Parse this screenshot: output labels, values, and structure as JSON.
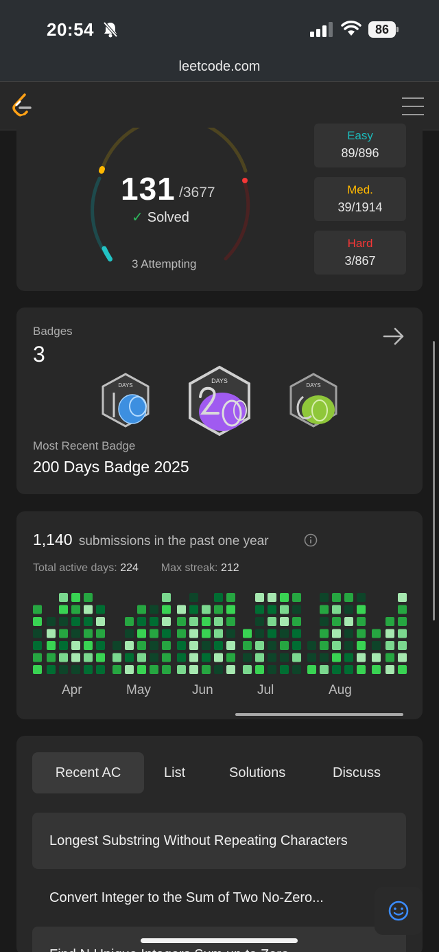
{
  "status_bar": {
    "time": "20:54",
    "battery": "86"
  },
  "browser": {
    "url": "leetcode.com"
  },
  "progress": {
    "solved": "131",
    "total": "/3677",
    "solved_label": "Solved",
    "attempting": "3 Attempting",
    "difficulties": [
      {
        "label": "Easy",
        "value": "89/896",
        "color": "#1cbaba"
      },
      {
        "label": "Med.",
        "value": "39/1914",
        "color": "#ffb800"
      },
      {
        "label": "Hard",
        "value": "3/867",
        "color": "#f63737"
      }
    ]
  },
  "badges": {
    "title": "Badges",
    "count": "3",
    "badge_icons": [
      "100-days-badge-icon",
      "200-days-badge-icon",
      "50-days-badge-icon"
    ],
    "badge_texts": [
      "DAYS",
      "DAYS",
      "DAYS"
    ],
    "recent_title": "Most Recent Badge",
    "recent_name": "200 Days Badge 2025"
  },
  "submissions": {
    "count": "1,140",
    "label": "submissions in the past one year",
    "active_label": "Total active days:",
    "active_value": "224",
    "streak_label": "Max streak:",
    "streak_value": "212",
    "months": [
      "Apr",
      "May",
      "Jun",
      "Jul",
      "Aug"
    ]
  },
  "tabs": [
    "Recent AC",
    "List",
    "Solutions",
    "Discuss"
  ],
  "recent_ac": [
    "Longest Substring Without Repeating Characters",
    "Convert Integer to the Sum of Two No-Zero...",
    "Find N Unique Integers Sum up to Zero"
  ],
  "colors": {
    "accent_green": "#2cbb5d",
    "easy": "#1cbaba",
    "medium": "#ffb800",
    "hard": "#f63737"
  }
}
